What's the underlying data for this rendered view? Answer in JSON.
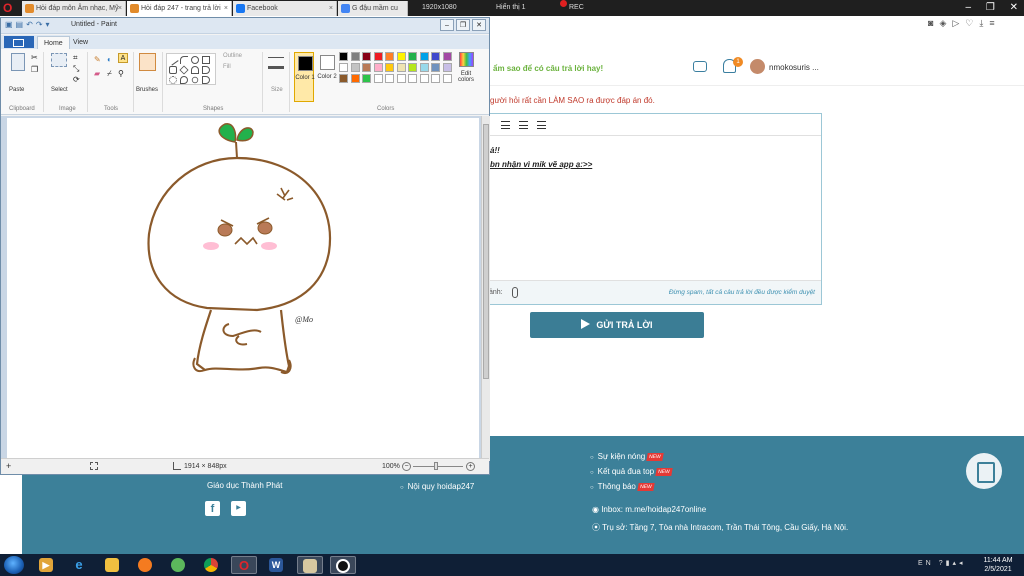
{
  "browser": {
    "tabs": [
      {
        "label": "Hỏi đáp môn Âm nhạc, Mỹ",
        "favicon_color": "#e28b2b"
      },
      {
        "label": "Hỏi đáp 247 - trang trả lời",
        "favicon_color": "#e28b2b"
      },
      {
        "label": "Facebook",
        "favicon_color": "#1877f2"
      },
      {
        "label": "G đậu mầm cu",
        "favicon_color": "#4285f4"
      }
    ],
    "recorder": {
      "resolution": "1920x1080",
      "display": "Hiển thị 1",
      "rec_label": "REC"
    }
  },
  "site": {
    "slogan": "ẩm sao để có câu trả lời hay!",
    "notification_count": "1",
    "username": "nmokosuris ...",
    "answer_hint": "gười hỏi rất cần LÀM SAO ra được đáp án đó.",
    "editor": {
      "line1": "ả!!",
      "line2": "bn nhận vì mik vẽ app ạ:>>",
      "attach_label": "ảnh:",
      "spam_note": "Đừng spam, tất cả câu trả lời đều được kiểm duyệt"
    },
    "submit_label": "GỬI TRẢ LỜI",
    "footer": {
      "company": "Giáo dục Thành Phát",
      "rules_link": "Nội quy hoidap247",
      "hot_events": "Sự kiện nóng",
      "contest_results": "Kết quả đua top",
      "announcements": "Thông báo",
      "new_badge": "NEW",
      "inbox": "Inbox: m.me/hoidap247online",
      "address": "Trụ sở: Tầng 7, Tòa nhà Intracom, Trần Thái Tông, Cầu Giấy, Hà Nội."
    }
  },
  "paint": {
    "title": "Untitled - Paint",
    "tabs": [
      "Home",
      "View"
    ],
    "groups": [
      "Clipboard",
      "Image",
      "Tools",
      "Shapes",
      "Colors"
    ],
    "buttons": {
      "paste": "Paste",
      "select": "Select",
      "brushes": "Brushes",
      "outline": "Outline",
      "fill": "Fill",
      "size": "Size",
      "color1": "Color 1",
      "color2": "Color 2",
      "edit_colors": "Edit colors"
    },
    "signature": "@Mo",
    "status": {
      "dimensions": "1914 × 848px",
      "zoom": "100%"
    },
    "palette_row1": [
      "#000000",
      "#7f7f7f",
      "#880015",
      "#ed1c24",
      "#ff7f27",
      "#fff200",
      "#22b14c",
      "#00a2e8",
      "#3f48cc",
      "#a349a4"
    ],
    "palette_row2": [
      "#ffffff",
      "#c3c3c3",
      "#b97a57",
      "#ffaec9",
      "#ffc90e",
      "#efe4b0",
      "#b5e61d",
      "#99d9ea",
      "#7092be",
      "#c8bfe7"
    ],
    "palette_row3": [
      "#8b5a2b",
      "#ff6a00",
      "#2ec34a",
      "#ffffff",
      "#ffffff",
      "#ffffff",
      "#ffffff",
      "#ffffff",
      "#ffffff",
      "#ffffff"
    ]
  },
  "taskbar": {
    "time": "11:44 AM",
    "date": "2/5/2021",
    "tray_lang": "EN"
  }
}
